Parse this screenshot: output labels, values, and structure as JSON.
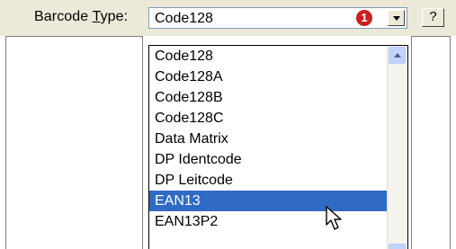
{
  "barcode": {
    "label_prefix": "Barcode ",
    "label_accel": "T",
    "label_suffix": "ype:",
    "selected_value": "Code128",
    "badge": "1",
    "help_label": "?"
  },
  "dropdown": {
    "items": [
      {
        "label": "Code128",
        "selected": false
      },
      {
        "label": "Code128A",
        "selected": false
      },
      {
        "label": "Code128B",
        "selected": false
      },
      {
        "label": "Code128C",
        "selected": false
      },
      {
        "label": "Data Matrix",
        "selected": false
      },
      {
        "label": "DP Identcode",
        "selected": false
      },
      {
        "label": "DP Leitcode",
        "selected": false
      },
      {
        "label": "EAN13",
        "selected": true
      },
      {
        "label": "EAN13P2",
        "selected": false
      }
    ],
    "highlight_color": "#316ac5"
  },
  "icons": {
    "combo_arrow": "chevron-down-icon",
    "scroll_up": "chevron-up-icon",
    "cursor": "mouse-pointer-icon"
  }
}
